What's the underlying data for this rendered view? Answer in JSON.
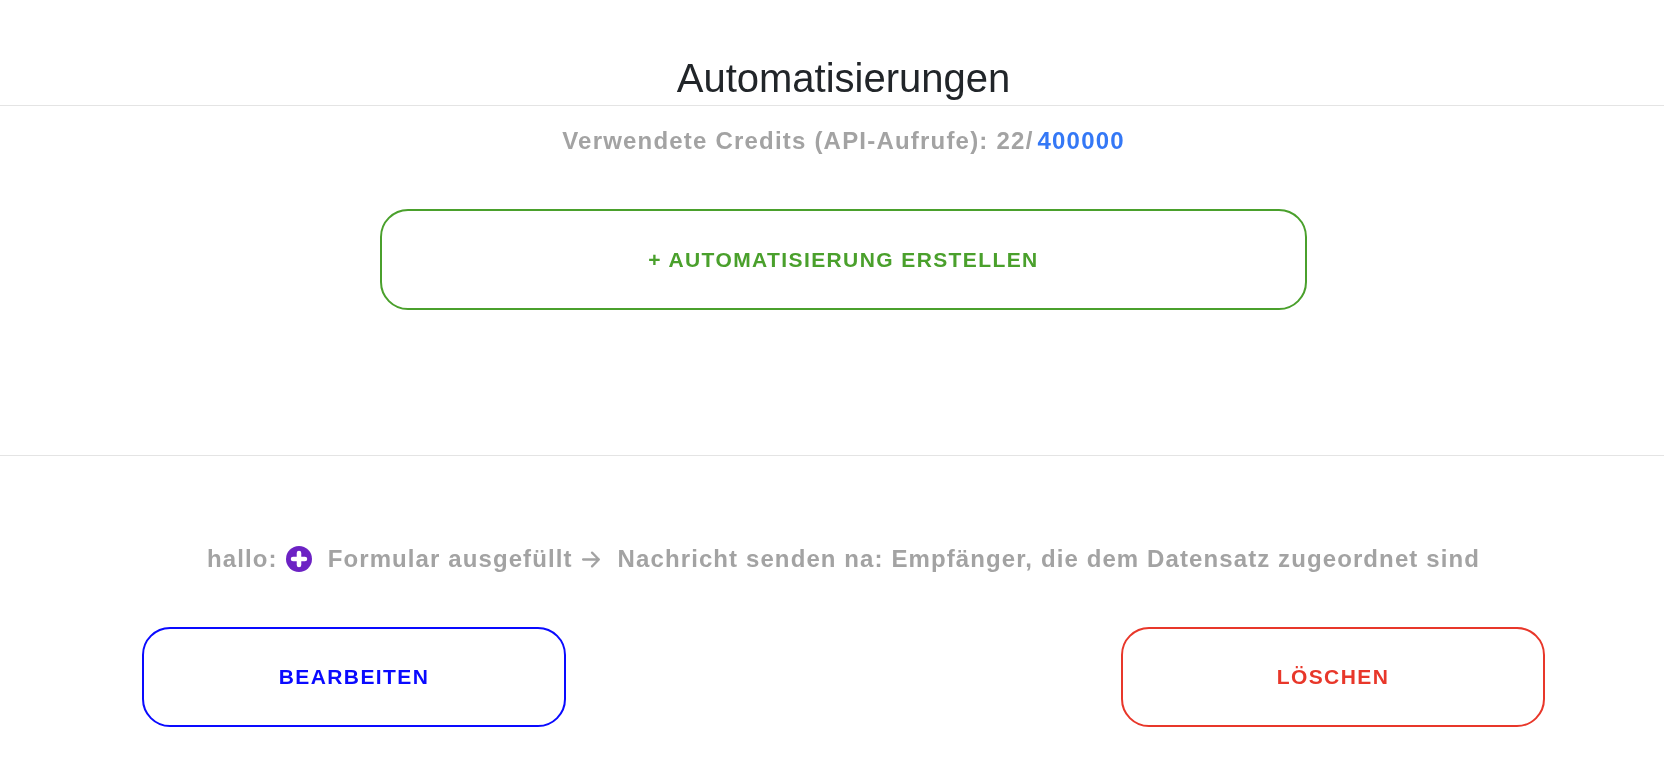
{
  "header": {
    "title": "Automatisierungen"
  },
  "credits": {
    "label": "Verwendete Credits (API-Aufrufe):",
    "used": "22/",
    "limit": "400000"
  },
  "create_button": {
    "label": "+ AUTOMATISIERUNG ERSTELLEN"
  },
  "automations": [
    {
      "name": "hallo:",
      "trigger": "Formular ausgefüllt",
      "action": "Nachricht senden na: Empfänger, die dem Datensatz zugeordnet sind",
      "buttons": [
        {
          "kind": "edit",
          "label": "BEARBEITEN"
        },
        {
          "kind": "delete",
          "label": "LÖSCHEN"
        }
      ]
    }
  ]
}
